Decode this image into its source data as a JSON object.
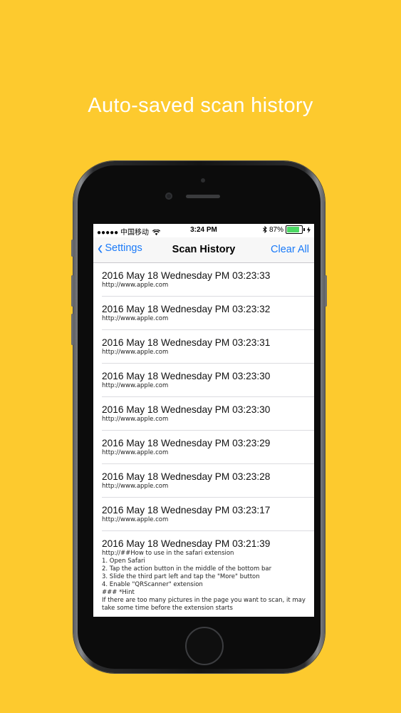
{
  "headline": "Auto-saved scan history",
  "status_bar": {
    "carrier": "●●●●● 中国移动",
    "wifi_icon": "wifi-icon",
    "time": "3:24 PM",
    "bluetooth_icon": "bluetooth-icon",
    "battery_percent": "87%",
    "battery_level": 0.87
  },
  "nav": {
    "back_label": "Settings",
    "title": "Scan History",
    "clear_label": "Clear All"
  },
  "history": [
    {
      "date": "2016 May 18 Wednesday PM 03:23:33",
      "content": "http://www.apple.com"
    },
    {
      "date": "2016 May 18 Wednesday PM 03:23:32",
      "content": "http://www.apple.com"
    },
    {
      "date": "2016 May 18 Wednesday PM 03:23:31",
      "content": "http://www.apple.com"
    },
    {
      "date": "2016 May 18 Wednesday PM 03:23:30",
      "content": "http://www.apple.com"
    },
    {
      "date": "2016 May 18 Wednesday PM 03:23:30",
      "content": "http://www.apple.com"
    },
    {
      "date": "2016 May 18 Wednesday PM 03:23:29",
      "content": "http://www.apple.com"
    },
    {
      "date": "2016 May 18 Wednesday PM 03:23:28",
      "content": "http://www.apple.com"
    },
    {
      "date": "2016 May 18 Wednesday PM 03:23:17",
      "content": "http://www.apple.com"
    },
    {
      "date": "2016 May 18 Wednesday PM 03:21:39",
      "content": "http://##How to use in the safari extension\n1. Open Safari\n2. Tap the action button in the middle of the bottom bar\n3. Slide the third part left and tap the \"More\" button\n4. Enable \"QRScanner\" extension\n### *Hint\nIf there are too many pictures in the page you want to scan, it may take some time before the extension starts"
    }
  ]
}
